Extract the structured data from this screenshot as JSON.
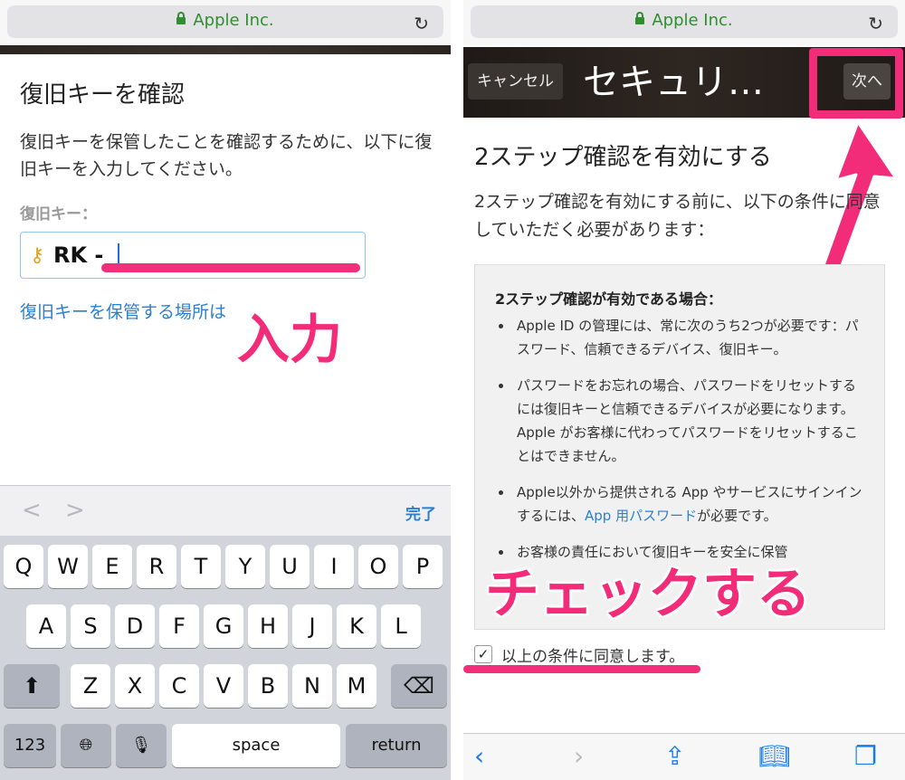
{
  "left": {
    "url_text": "Apple Inc.",
    "title": "復旧キーを確認",
    "description": "復旧キーを保管したことを確認するために、以下に復旧キーを入力してください。",
    "key_label": "復旧キー：",
    "key_value": "RK -",
    "link_text": "復旧キーを保管する場所は",
    "annotation": "入力",
    "accessory": {
      "done": "完了"
    },
    "keyboard": {
      "row1": [
        "Q",
        "W",
        "E",
        "R",
        "T",
        "Y",
        "U",
        "I",
        "O",
        "P"
      ],
      "row2": [
        "A",
        "S",
        "D",
        "F",
        "G",
        "H",
        "J",
        "K",
        "L"
      ],
      "row3": [
        "Z",
        "X",
        "C",
        "V",
        "B",
        "N",
        "M"
      ],
      "numbers_key": "123",
      "space_key": "space",
      "return_key": "return"
    }
  },
  "right": {
    "url_text": "Apple Inc.",
    "cancel": "キャンセル",
    "header_title": "セキュリ…",
    "next": "次へ",
    "title": "2ステップ確認を有効にする",
    "description": "2ステップ確認を有効にする前に、以下の条件に同意していただく必要があります：",
    "box_title": "2ステップ確認が有効である場合：",
    "bullets": [
      "Apple ID の管理には、常に次のうち2つが必要です：パスワード、信頼できるデバイス、復旧キー。",
      "パスワードをお忘れの場合、パスワードをリセットするには復旧キーと信頼できるデバイスが必要になります。Apple がお客様に代わってパスワードをリセットすることはできません。"
    ],
    "bullet3_before": "Apple以外から提供される App やサービスにサインインするには、",
    "bullet3_link": "App 用パスワード",
    "bullet3_after": "が必要です。",
    "bullet4": "お客様の責任において復旧キーを安全に保管",
    "annotation": "チェックする",
    "agree_label": "以上の条件に同意します。",
    "agree_checked": true
  }
}
